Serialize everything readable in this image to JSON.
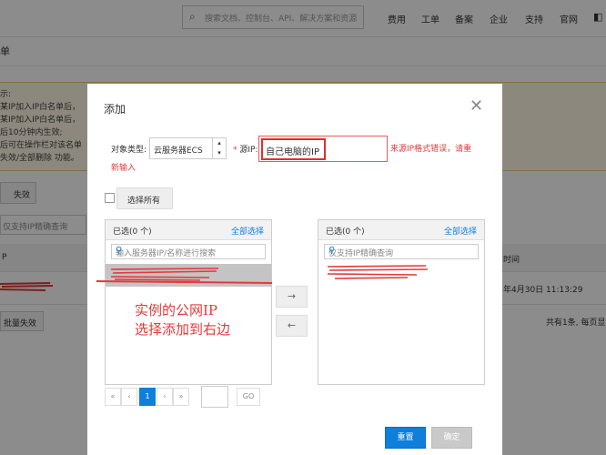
{
  "topbar": {
    "search_placeholder": "搜索文档、控制台、API、解决方案和资源",
    "nav": [
      "费用",
      "工单",
      "备案",
      "企业",
      "支持",
      "官网"
    ]
  },
  "background": {
    "title": "单",
    "notice_lines": [
      "示:",
      "某IP加入IP白名单后，",
      "某IP加入IP白名单后，",
      "后10分钟内生效;",
      "后可在操作栏对该名单",
      "失效/全部删除 功能。"
    ],
    "fail_tab": "失效",
    "search_placeholder": "仅支持IP精确查询",
    "col_ip": "P",
    "col_time": "时间",
    "row_time": "年4月30日 11:13:29",
    "batch_fail_button": "批量失效",
    "footer_text": "共有1条, 每页显"
  },
  "dialog": {
    "title": "添加",
    "object_type_label": "对象类型:",
    "object_type_value": "云服务器ECS",
    "source_ip_label": "源IP:",
    "source_ip_value": "自己电脑的IP",
    "error_line1": "来源IP格式错误，请重",
    "error_line2": "新输入",
    "select_all_label": "选择所有",
    "left_panel": {
      "count_label": "已选(0 个)",
      "select_all_link": "全部选择",
      "search_placeholder": "输入服务器IP/名称进行搜索"
    },
    "right_panel": {
      "count_label": "已选(0 个)",
      "select_all_link": "全部选择",
      "search_placeholder": "仅支持IP精确查询"
    },
    "annotation_line1": "实例的公网IP",
    "annotation_line2": "选择添加到右边",
    "pagination": {
      "first": "«",
      "prev": "‹",
      "current": "1",
      "next": "›",
      "last": "»",
      "go": "GO"
    },
    "reset_button": "重置",
    "ok_button": "确定",
    "move_right_icon": "→",
    "move_left_icon": "←",
    "close_icon": "✕"
  },
  "colors": {
    "accent": "#0e7fdb",
    "error": "#e4393c",
    "warn_bg": "#fff7e6"
  }
}
